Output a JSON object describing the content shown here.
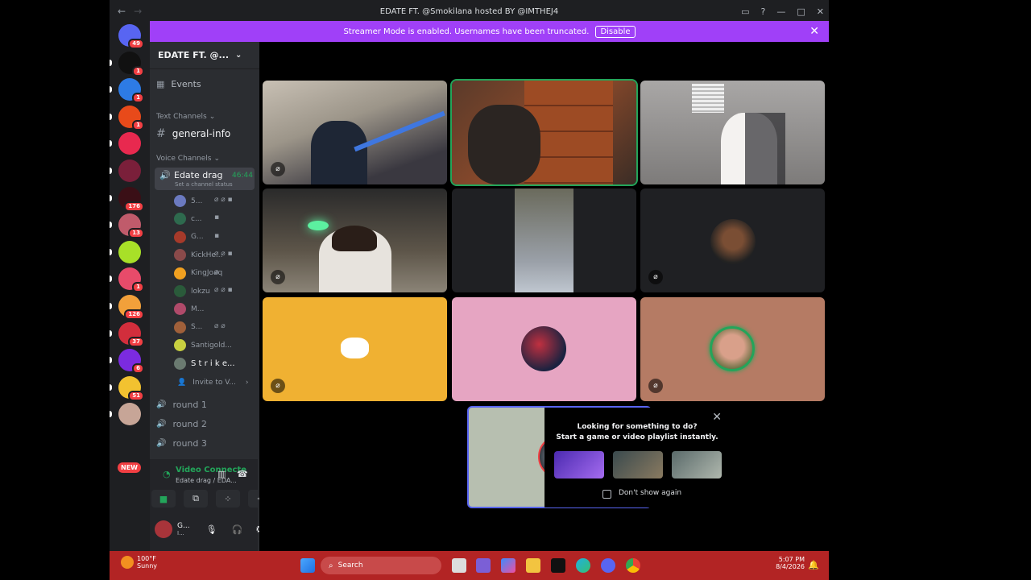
{
  "window": {
    "title": "EDATE FT. @Smokilana hosted BY @IMTHEJ4",
    "back": "←",
    "forward": "→"
  },
  "banner": {
    "text": "Streamer Mode is enabled. Usernames have been truncated.",
    "button": "Disable"
  },
  "guilds": [
    {
      "badge": "49",
      "color": "#5865f2"
    },
    {
      "badge": "1",
      "color": "#111"
    },
    {
      "badge": "1",
      "color": "#2d7be5"
    },
    {
      "badge": "1",
      "color": "#e84a1a"
    },
    {
      "badge": "",
      "color": "#e8294f"
    },
    {
      "badge": "",
      "color": "#7a1f3a"
    },
    {
      "badge": "176",
      "color": "#3a0f16"
    },
    {
      "badge": "13",
      "color": "#c05b6b"
    },
    {
      "badge": "",
      "color": "#a8e028"
    },
    {
      "badge": "1",
      "color": "#e84b6a"
    },
    {
      "badge": "126",
      "color": "#f2a03a"
    },
    {
      "badge": "37",
      "color": "#d22e3c"
    },
    {
      "badge": "6",
      "color": "#7b2be0"
    },
    {
      "badge": "51",
      "color": "#f2c230"
    },
    {
      "badge": "",
      "color": "#c7a597"
    }
  ],
  "new_badge": "NEW",
  "server": {
    "name": "EDATE FT. @..."
  },
  "channels": {
    "events": "Events",
    "text_category": "Text Channels",
    "general": "general-info",
    "voice_category": "Voice Channels",
    "voice_active": "Edate drag",
    "voice_timer": "46:44",
    "channel_status": "Set a channel status",
    "members": [
      "5...",
      "c...",
      "G...",
      "KickHe...",
      "KingJoaq",
      "lokzu",
      "M...",
      "S...",
      "Santigold...",
      "S t r i k e..."
    ],
    "invite": "Invite to V...",
    "others": [
      "round 1",
      "round 2",
      "round 3"
    ]
  },
  "voice_panel": {
    "status": "Video Connecte",
    "sub": "Edate drag / EDA..."
  },
  "user_panel": {
    "name": "G...",
    "sub": "I..."
  },
  "popup": {
    "title1": "Looking for something to do?",
    "title2": "Start a game or video playlist instantly.",
    "checkbox": "Don't show again"
  },
  "taskbar": {
    "temp": "100°F",
    "weather": "Sunny",
    "search": "Search",
    "time": "5:07 PM",
    "date": "8/4/2026"
  },
  "colors": {
    "discord_blurple": "#5865f2",
    "streamer_purple": "#a040f8",
    "online_green": "#23a55a",
    "taskbar_red": "#b22424"
  }
}
